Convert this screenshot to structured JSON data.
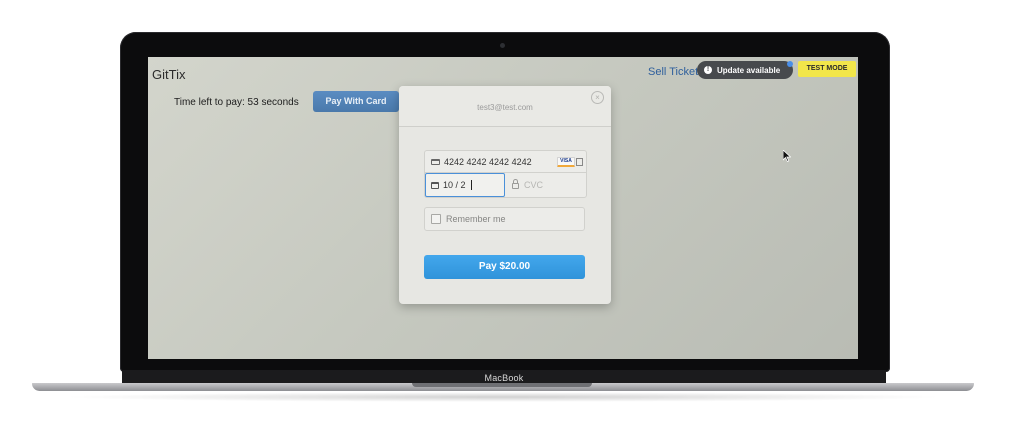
{
  "device": {
    "brand_label": "MacBook"
  },
  "app": {
    "title": "GitTix",
    "sell_link": "Sell Ticket",
    "update_pill": {
      "icon": "info-icon",
      "label": "Update available"
    },
    "test_mode_badge": "TEST MODE",
    "time_left": "Time left to pay: 53 seconds",
    "pay_card_label": "Pay With Card"
  },
  "checkout": {
    "email": "test3@test.com",
    "close_glyph": "×",
    "card_number": "4242 4242 4242 4242",
    "card_brand_icon": "visa-card-icon",
    "expiry_value": "10 / 2",
    "cvc_placeholder": "CVC",
    "remember_label": "Remember me",
    "pay_button_label": "Pay $20.00"
  },
  "colors": {
    "pay_button": "#3a9de3",
    "test_mode": "#f2e64a",
    "link": "#2e5f9c",
    "focus_ring": "#4a90d9"
  }
}
